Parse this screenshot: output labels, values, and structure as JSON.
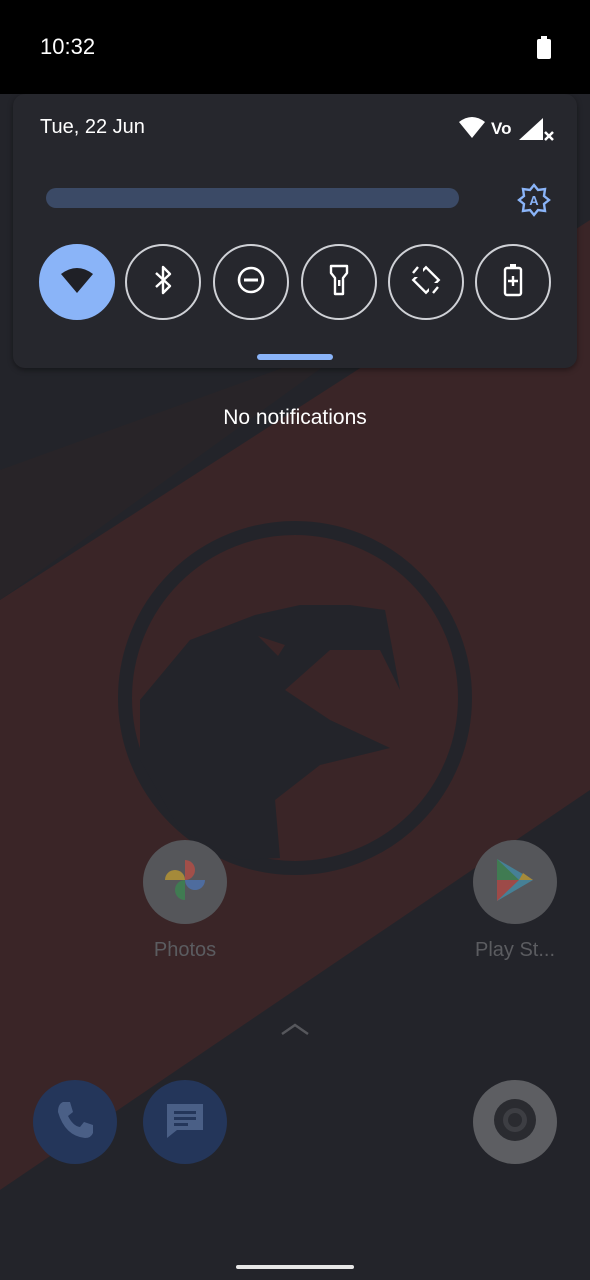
{
  "status_bar": {
    "time": "10:32"
  },
  "quick_settings": {
    "date": "Tue, 22 Jun",
    "brightness_level": 0.0,
    "network_label": "Vo",
    "tiles": [
      {
        "name": "wifi",
        "active": true
      },
      {
        "name": "bluetooth",
        "active": false
      },
      {
        "name": "do-not-disturb",
        "active": false
      },
      {
        "name": "flashlight",
        "active": false
      },
      {
        "name": "auto-rotate",
        "active": false
      },
      {
        "name": "battery-saver",
        "active": false
      }
    ]
  },
  "notifications": {
    "empty_text": "No notifications"
  },
  "home": {
    "apps": [
      {
        "label": "Photos"
      },
      {
        "label": "Play St..."
      }
    ],
    "dock": [
      "phone",
      "messages",
      "camera"
    ]
  },
  "colors": {
    "accent": "#8ab4f8",
    "panel": "#26272d",
    "wallpaper_red": "#3a2527",
    "wallpaper_dark": "#24252b"
  }
}
